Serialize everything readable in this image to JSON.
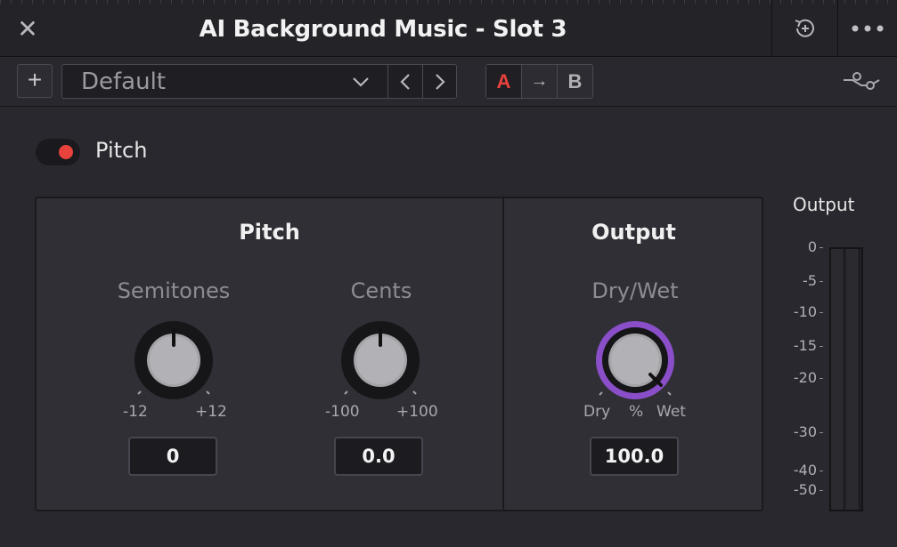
{
  "window": {
    "title": "AI Background Music - Slot 3"
  },
  "toolbar": {
    "preset_value": "Default",
    "compare": {
      "a_label": "A",
      "arrow_label": "→",
      "b_label": "B",
      "active": "A"
    }
  },
  "plugin": {
    "enabled": true,
    "enable_label": "Pitch"
  },
  "sections": {
    "pitch": {
      "title": "Pitch",
      "semitones": {
        "label": "Semitones",
        "min_label": "-12",
        "max_label": "+12",
        "value": "0"
      },
      "cents": {
        "label": "Cents",
        "min_label": "-100",
        "max_label": "+100",
        "value": "0.0"
      }
    },
    "output": {
      "title": "Output",
      "drywet": {
        "label": "Dry/Wet",
        "min_label": "Dry",
        "unit_label": "%",
        "max_label": "Wet",
        "value": "100.0"
      }
    }
  },
  "meter": {
    "title": "Output",
    "ticks": [
      "0",
      "-5",
      "-10",
      "-15",
      "-20",
      "-30",
      "-40",
      "-50"
    ]
  },
  "colors": {
    "accent_red": "#e8423d",
    "drywet_arc": "#8a4fc8"
  }
}
